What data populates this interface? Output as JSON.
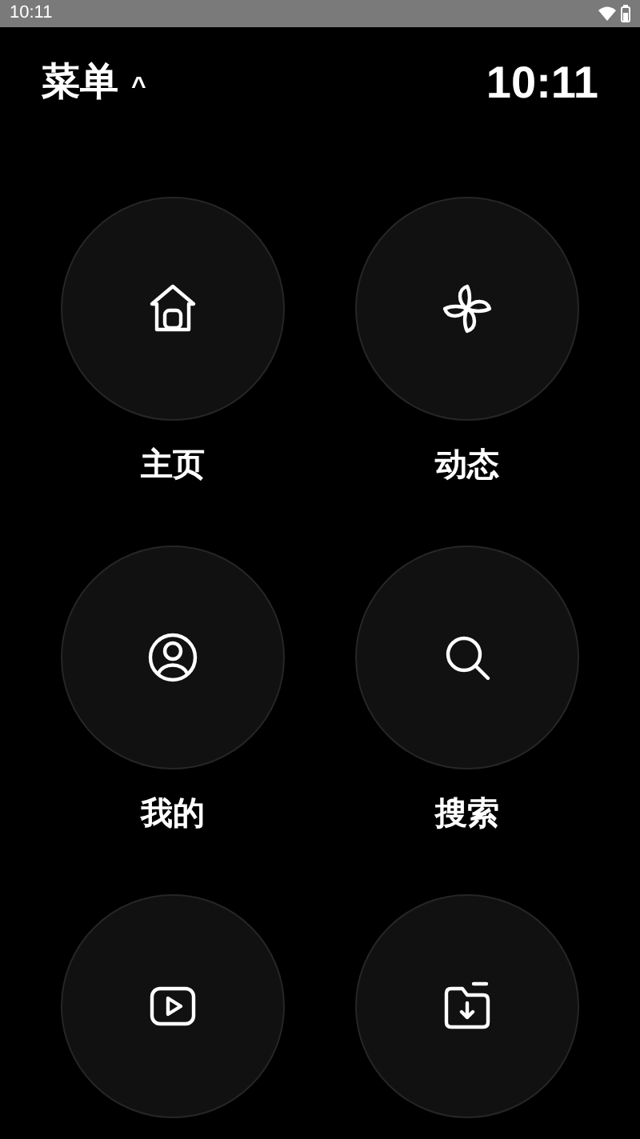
{
  "status_bar": {
    "time": "10:11"
  },
  "header": {
    "title": "菜单",
    "caret": "^",
    "clock": "10:11"
  },
  "menu": [
    {
      "kind": "home",
      "label": "主页"
    },
    {
      "kind": "pinwheel",
      "label": "动态"
    },
    {
      "kind": "user",
      "label": "我的"
    },
    {
      "kind": "search",
      "label": "搜索"
    },
    {
      "kind": "play"
    },
    {
      "kind": "folder-download"
    }
  ]
}
